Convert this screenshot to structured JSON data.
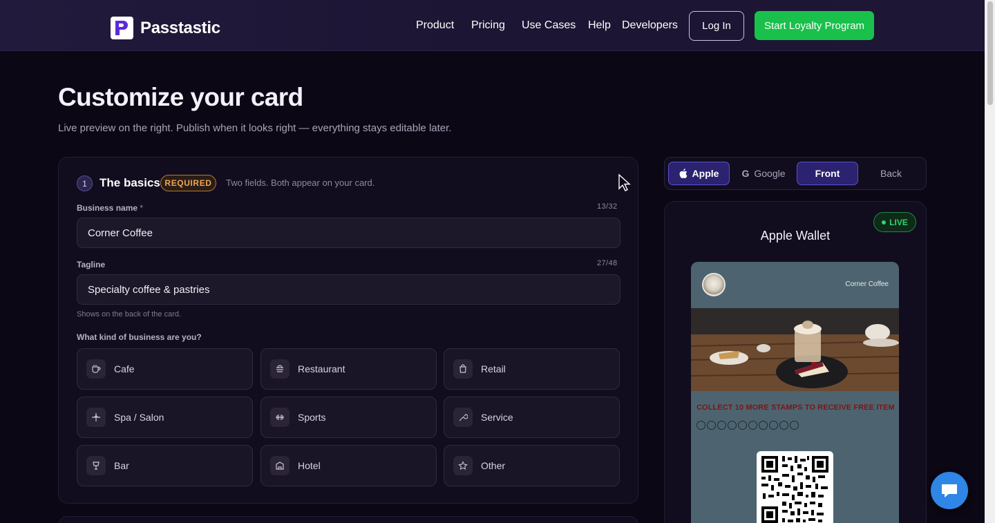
{
  "header": {
    "brand": "Passtastic",
    "nav": [
      "Product",
      "Pricing",
      "Use Cases",
      "Help",
      "Developers"
    ],
    "login_label": "Log In",
    "cta_label": "Start Loyalty Program"
  },
  "page": {
    "title": "Customize your card",
    "subtitle": "Live preview on the right. Publish when it looks right — everything stays editable later."
  },
  "basics": {
    "step": "1",
    "title": "The basics",
    "badge": "REQUIRED",
    "hint": "Two fields. Both appear on your card.",
    "business_name": {
      "label": "Business name",
      "required_mark": "*",
      "counter": "13/32",
      "value": "Corner Coffee"
    },
    "tagline": {
      "label": "Tagline",
      "counter": "27/48",
      "value": "Specialty coffee & pastries",
      "helper": "Shows on the back of the card."
    },
    "business_type_label": "What kind of business are you?",
    "business_types": [
      {
        "label": "Cafe",
        "icon": "coffee-cup-icon"
      },
      {
        "label": "Restaurant",
        "icon": "dish-icon"
      },
      {
        "label": "Retail",
        "icon": "shopping-bag-icon"
      },
      {
        "label": "Spa / Salon",
        "icon": "sparkle-icon"
      },
      {
        "label": "Sports",
        "icon": "dumbbell-icon"
      },
      {
        "label": "Service",
        "icon": "wrench-icon"
      },
      {
        "label": "Bar",
        "icon": "cocktail-icon"
      },
      {
        "label": "Hotel",
        "icon": "building-icon"
      },
      {
        "label": "Other",
        "icon": "star-icon"
      }
    ]
  },
  "preview": {
    "toggles": [
      "Apple",
      "Google",
      "Front",
      "Back"
    ],
    "active_platform": "Apple",
    "active_side": "Front",
    "live_label": "LIVE",
    "wallet_title": "Apple Wallet",
    "card": {
      "business_name": "Corner Coffee",
      "collect_text": "COLLECT 10 MORE STAMPS TO RECEIVE FREE ITEM",
      "stamps_total": 10,
      "stamps_filled": 0,
      "background_color": "#4d6470",
      "collect_color": "#7a1616"
    }
  },
  "colors": {
    "accent_green": "#19c04b",
    "accent_purple": "#5b4fd0",
    "required_orange": "#f0a45c",
    "live_green": "#2fd56a"
  }
}
